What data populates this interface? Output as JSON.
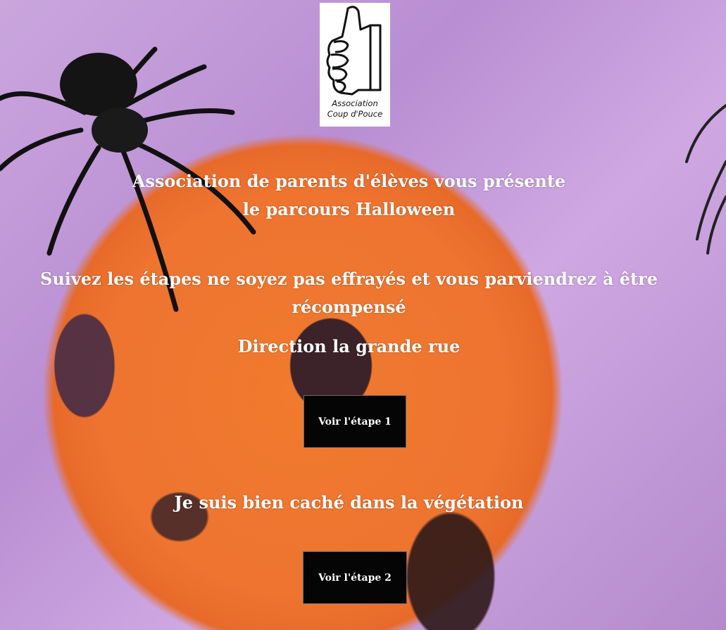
{
  "logo": {
    "line1": "Association",
    "line2": "Coup d'Pouce"
  },
  "intro": {
    "line1": "Association de parents d'élèves vous présente",
    "line2": "le parcours Halloween"
  },
  "instruction": "Suivez les étapes ne soyez pas effrayés et vous parviendrez à être récompensé",
  "step1": {
    "hint": "Direction la grande rue",
    "button_label": "Voir l'étape 1"
  },
  "step2": {
    "hint": "Je suis bien caché dans la végétation",
    "button_label": "Voir l'étape 2"
  },
  "colors": {
    "pumpkin": "#ee7430",
    "background": "#c9a0dc",
    "button": "#050505",
    "text": "#ffffff"
  },
  "icons": {
    "logo": "thumbs-up-icon",
    "decoration": "spider-icon"
  }
}
